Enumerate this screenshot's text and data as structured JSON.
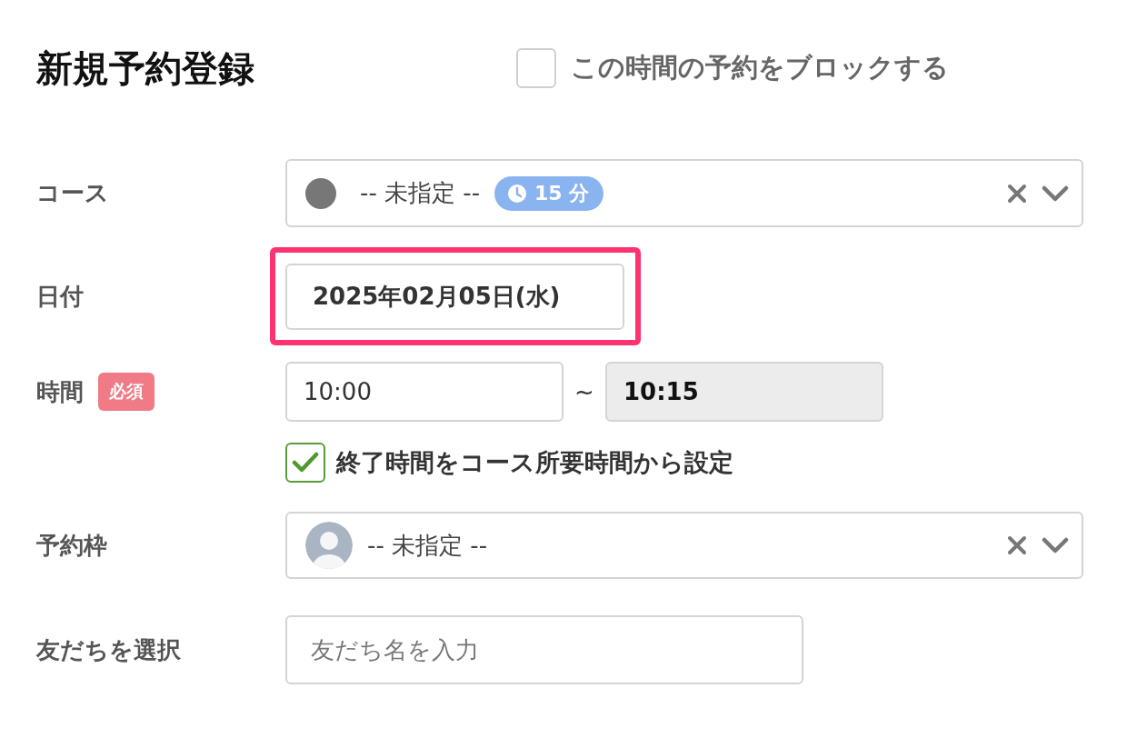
{
  "title": "新規予約登録",
  "block_option": {
    "label": "この時間の予約をブロックする",
    "checked": false
  },
  "course": {
    "label": "コース",
    "value": "-- 未指定 --",
    "duration": "15 分"
  },
  "date": {
    "label": "日付",
    "value": "2025年02月05日(水)",
    "highlighted": true
  },
  "time": {
    "label": "時間",
    "required_badge": "必須",
    "start": "10:00",
    "separator": "~",
    "end": "10:15",
    "end_disabled": true
  },
  "auto_end": {
    "label": "終了時間をコース所要時間から設定",
    "checked": true
  },
  "slot": {
    "label": "予約枠",
    "value": "-- 未指定 --"
  },
  "friend": {
    "label": "友だちを選択",
    "placeholder": "友だち名を入力"
  }
}
